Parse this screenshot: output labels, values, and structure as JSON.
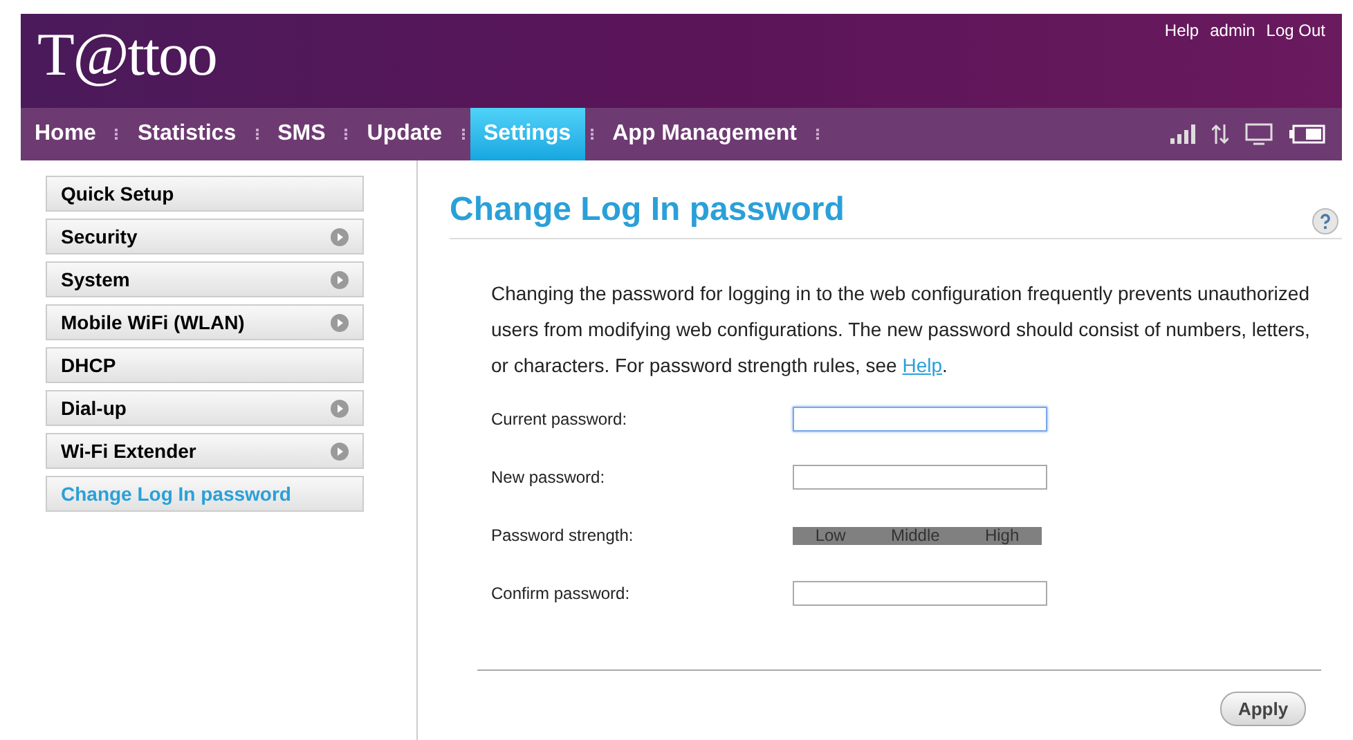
{
  "header": {
    "logo": "T@ttoo",
    "links": [
      "Help",
      "admin",
      "Log Out"
    ]
  },
  "nav": [
    {
      "label": "Home",
      "selected": false
    },
    {
      "label": "Statistics",
      "selected": false
    },
    {
      "label": "SMS",
      "selected": false
    },
    {
      "label": "Update",
      "selected": false
    },
    {
      "label": "Settings",
      "selected": true
    },
    {
      "label": "App Management",
      "selected": false
    }
  ],
  "sidebar": {
    "items": [
      {
        "label": "Quick Setup",
        "selected": false,
        "has_submenu": false
      },
      {
        "label": "Security",
        "selected": false,
        "has_submenu": true
      },
      {
        "label": "System",
        "selected": false,
        "has_submenu": true
      },
      {
        "label": "Mobile WiFi (WLAN)",
        "selected": false,
        "has_submenu": true
      },
      {
        "label": "DHCP",
        "selected": false,
        "has_submenu": false
      },
      {
        "label": "Dial-up",
        "selected": false,
        "has_submenu": true
      },
      {
        "label": "Wi-Fi Extender",
        "selected": false,
        "has_submenu": true
      },
      {
        "label": "Change Log In password",
        "selected": true,
        "has_submenu": false
      }
    ]
  },
  "main": {
    "title": "Change Log In password",
    "description": "Changing the password for logging in to the web configuration frequently prevents unauthorized users from modifying web configurations. The new password should consist of numbers, letters, or characters. For password strength rules, see ",
    "description_link": "Help",
    "description_end": ".",
    "form": [
      {
        "kind": "field",
        "label": "Current password:",
        "focused": true
      },
      {
        "kind": "field",
        "label": "New password:",
        "focused": false
      },
      {
        "kind": "strength",
        "label": "Password strength:",
        "levels": [
          "Low",
          "Middle",
          "High"
        ]
      },
      {
        "kind": "field",
        "label": "Confirm password:",
        "focused": false
      }
    ],
    "apply": "Apply"
  }
}
